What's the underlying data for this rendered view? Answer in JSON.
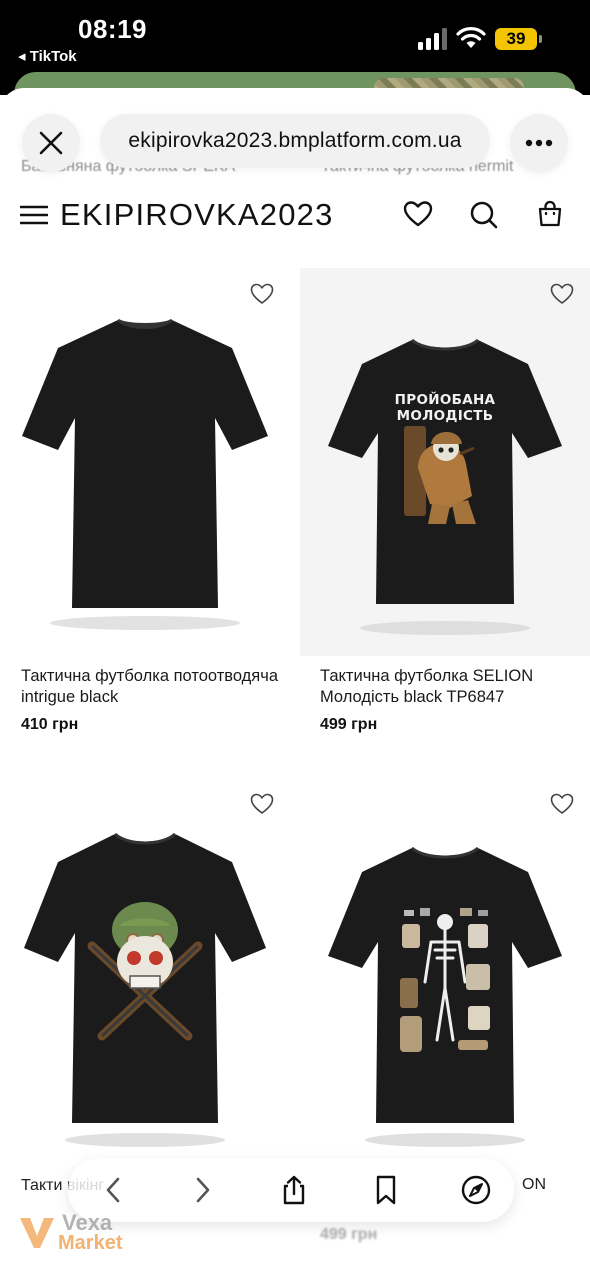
{
  "status_bar": {
    "time": "08:19",
    "back_app": "◂ TikTok",
    "battery": "39",
    "signal_icon": "cellular-signal-icon",
    "wifi_icon": "wifi-icon"
  },
  "browser": {
    "url": "ekipirovka2023.bmplatform.com.ua",
    "close_icon": "close-icon",
    "more_icon": "more-dots-icon"
  },
  "faded_previous_titles": {
    "left": "Бавовняна футболка SPEKA",
    "right": "Тактична футболка hermit"
  },
  "site": {
    "brand": "EKIPIROVKA2023",
    "icons": [
      "menu-icon",
      "heart-icon",
      "search-icon",
      "bag-icon"
    ]
  },
  "products": [
    {
      "title": "Тактична футболка потоотводяча intrigue black",
      "price": "410 грн",
      "print": "plain"
    },
    {
      "title": "Тактична футболка SELION Молодість black TP6847",
      "price": "499 грн",
      "print": "ПРОЙОБАНА МОЛОДІСТЬ"
    },
    {
      "title": "Такти вікінг",
      "price": "",
      "print": "skull-rifles"
    },
    {
      "title": "",
      "price": "499 грн",
      "print": "skeleton-gear",
      "title_tail": "ON"
    }
  ],
  "toolbar": {
    "icons": [
      "back-arrow-icon",
      "forward-arrow-icon",
      "share-icon",
      "bookmark-icon",
      "compass-icon"
    ]
  },
  "watermark": {
    "line1": "Vexa",
    "line2": "Market"
  },
  "colors": {
    "shirt": "#1b1b1b",
    "accent_watermark": "#f0a050",
    "battery": "#f5c400"
  }
}
